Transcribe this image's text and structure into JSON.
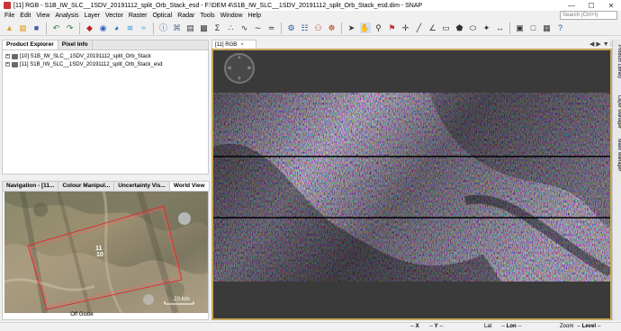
{
  "window": {
    "title": "[11] RGB - S1B_IW_SLC__1SDV_20191112_split_Orb_Stack_esd - F:\\DEM 4\\S1B_IW_SLC__1SDV_20191112_split_Orb_Stack_esd.dim - SNAP"
  },
  "menu": [
    "File",
    "Edit",
    "View",
    "Analysis",
    "Layer",
    "Vector",
    "Raster",
    "Optical",
    "Radar",
    "Tools",
    "Window",
    "Help"
  ],
  "search": {
    "placeholder": "Search (Ctrl+I)"
  },
  "product_panel": {
    "tabs": [
      "Product Explorer",
      "Pixel Info"
    ],
    "items": [
      {
        "label": "[10] S1B_IW_SLC__1SDV_20191112_split_Orb_Stack"
      },
      {
        "label": "[11] S1B_IW_SLC__1SDV_20191112_split_Orb_Stack_esd"
      }
    ]
  },
  "nav_panel": {
    "tabs": [
      "Navigation - [11...",
      "Colour Manipul...",
      "Uncertainty Vis...",
      "World View"
    ],
    "labels": {
      "product_top": "11",
      "product_bottom": "10",
      "scale": "20 km"
    },
    "footer": "Off Globe"
  },
  "image_view": {
    "tab_label": "[11] RGB"
  },
  "right_sidebar": {
    "tabs": [
      "Product Library",
      "Layer Manager",
      "Mask Manager"
    ]
  },
  "status_bar": {
    "x": "X",
    "y": "Y",
    "lat": "Lat",
    "lon": "Lon",
    "zoom": "Zoom",
    "level": "Level"
  },
  "colors": {
    "view_border": "#c7a85a",
    "footprint": "#e03030",
    "canvas_bg": "#3a3a3a"
  }
}
